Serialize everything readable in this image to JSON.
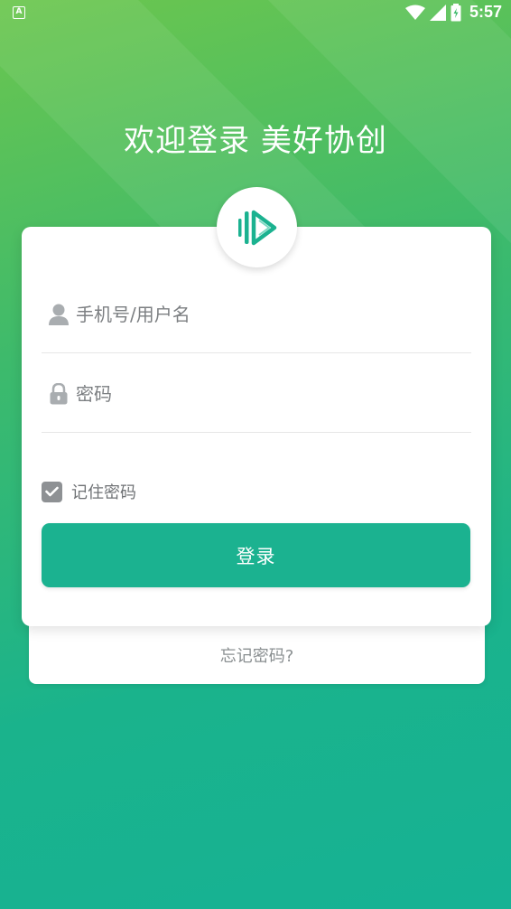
{
  "status_bar": {
    "app_indicator": "A",
    "time": "5:57",
    "icons": [
      "wifi-icon",
      "cell-signal-icon",
      "battery-icon"
    ]
  },
  "welcome_title": "欢迎登录 美好协创",
  "logo": {
    "icon": "app-logo-icon",
    "color": "#1bb290"
  },
  "form": {
    "username_placeholder": "手机号/用户名",
    "username_value": "",
    "username_icon": "user-icon",
    "password_placeholder": "密码",
    "password_value": "",
    "password_icon": "lock-icon",
    "remember_label": "记住密码",
    "remember_checked": true,
    "login_label": "登录"
  },
  "forgot_password": "忘记密码?",
  "colors": {
    "primary": "#1bb290",
    "gradient_top": "#6cc64e",
    "gradient_bottom": "#16b294"
  }
}
